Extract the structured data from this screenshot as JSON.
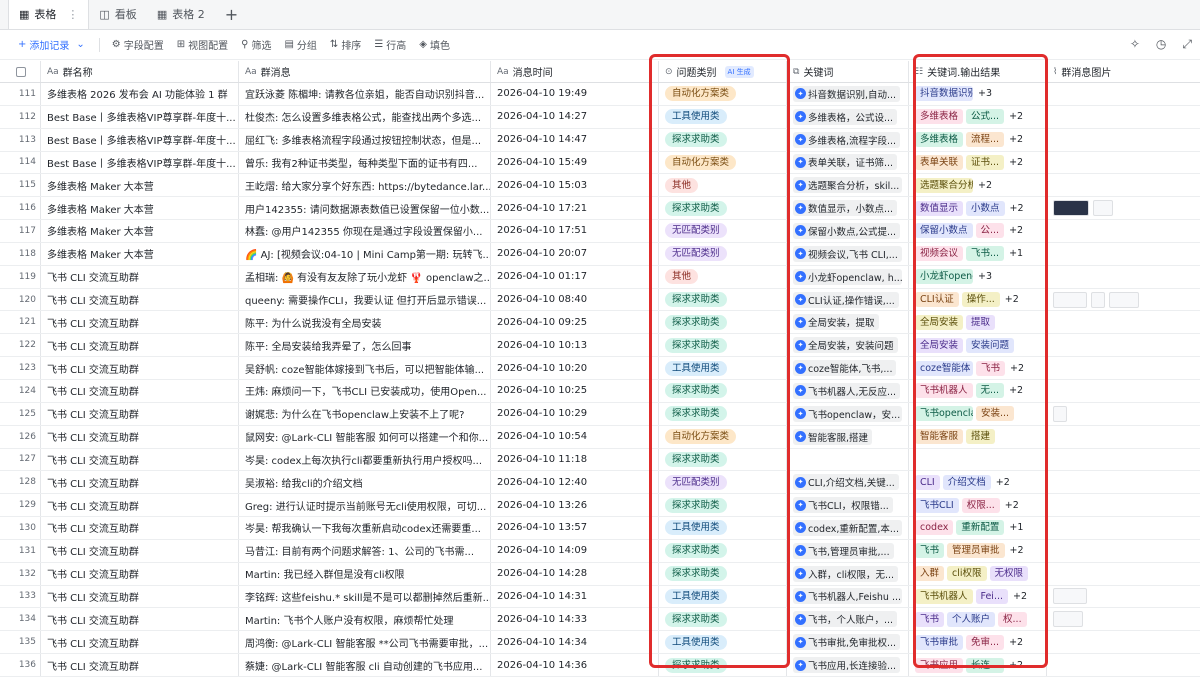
{
  "tabs": [
    {
      "label": "表格",
      "active": true,
      "icon": "table-icon"
    },
    {
      "label": "看板",
      "active": false,
      "icon": "kanban-icon"
    },
    {
      "label": "表格 2",
      "active": false,
      "icon": "table-icon"
    }
  ],
  "toolbar": {
    "add_record": "添加记录",
    "field_config": "字段配置",
    "view_config": "视图配置",
    "filter": "筛选",
    "group": "分组",
    "sort": "排序",
    "row_height": "行高",
    "fill": "填色"
  },
  "columns": {
    "group_name": "群名称",
    "group_message": "群消息",
    "message_time": "消息时间",
    "question_type": "问题类别",
    "ai_badge": "AI 生成",
    "keywords": "关键词",
    "keywords_output": "关键词.输出结果",
    "message_images": "群消息图片"
  },
  "rows": [
    {
      "no": "111",
      "group": "多维表格 2026 发布会 AI 功能体验 1 群",
      "msg": "宜跃泳菱 陈楣坤: 请教各位亲姐，能否自动识别抖音...",
      "time": "2026-04-10 19:49",
      "type": "自动化方案类",
      "tc": "o-auto",
      "kw": "抖音数据识别,自动...",
      "tags": [
        "抖音数据识别"
      ],
      "more": "+3",
      "imgs": []
    },
    {
      "no": "112",
      "group": "Best Base丨多维表格VIP尊享群-年度十...",
      "msg": "杜俊杰: 怎么设置多维表格公式，能查找出两个多选...",
      "time": "2026-04-10 14:27",
      "type": "工具使用类",
      "tc": "o-tool",
      "kw": "多维表格，公式设...",
      "tags": [
        "多维表格",
        "公式..."
      ],
      "more": "+2",
      "imgs": []
    },
    {
      "no": "113",
      "group": "Best Base丨多维表格VIP尊享群-年度十...",
      "msg": "屈红飞: 多维表格流程字段通过按钮控制状态，但是...",
      "time": "2026-04-10 14:47",
      "type": "探求求助类",
      "tc": "o-help",
      "kw": "多维表格,流程字段...",
      "tags": [
        "多维表格",
        "流程..."
      ],
      "more": "+2",
      "imgs": []
    },
    {
      "no": "114",
      "group": "Best Base丨多维表格VIP尊享群-年度十...",
      "msg": "曾乐: 我有2种证书类型，每种类型下面的证书有四...",
      "time": "2026-04-10 15:49",
      "type": "自动化方案类",
      "tc": "o-auto",
      "kw": "表单关联，证书筛...",
      "tags": [
        "表单关联",
        "证书..."
      ],
      "more": "+2",
      "imgs": []
    },
    {
      "no": "115",
      "group": "多维表格 Maker 大本营",
      "msg": "王屹熠: 给大家分享个好东西: https://bytedance.lar...",
      "time": "2026-04-10 15:03",
      "type": "其他",
      "tc": "o-other",
      "kw": "选题聚合分析，skil...",
      "tags": [
        "选题聚合分析"
      ],
      "more": "+2",
      "imgs": []
    },
    {
      "no": "116",
      "group": "多维表格 Maker 大本营",
      "msg": "用户142355: 请问数据源表数值已设置保留一位小数...",
      "time": "2026-04-10 17:21",
      "type": "探求求助类",
      "tc": "o-help",
      "kw": "数值显示，小数点...",
      "tags": [
        "数值显示",
        "小数点"
      ],
      "more": "+2",
      "imgs": [
        "dark",
        "w20"
      ]
    },
    {
      "no": "117",
      "group": "多维表格 Maker 大本营",
      "msg": "林蠢: @用户142355 你现在是通过字段设置保留小...",
      "time": "2026-04-10 17:51",
      "type": "无匹配类别",
      "tc": "o-none",
      "kw": "保留小数点,公式提...",
      "tags": [
        "保留小数点",
        "公..."
      ],
      "more": "+2",
      "imgs": []
    },
    {
      "no": "118",
      "group": "多维表格 Maker 大本营",
      "msg": "🌈 AJ: [视频会议:04-10 | Mini Camp第一期: 玩转飞...",
      "time": "2026-04-10 20:07",
      "type": "无匹配类别",
      "tc": "o-none",
      "kw": "视频会议,飞书 CLI,...",
      "tags": [
        "视频会议",
        "飞书..."
      ],
      "more": "+1",
      "imgs": []
    },
    {
      "no": "119",
      "group": "飞书 CLI 交流互助群",
      "msg": "孟相瑞: 🙆 有没有友友除了玩小龙虾 🦞 openclaw之...",
      "time": "2026-04-10 01:17",
      "type": "其他",
      "tc": "o-other",
      "kw": "小龙虾openclaw, h...",
      "tags": [
        "小龙虾openclaw"
      ],
      "more": "+3",
      "imgs": []
    },
    {
      "no": "120",
      "group": "飞书 CLI 交流互助群",
      "msg": "queeny: 需要操作CLI，我要认证 但打开后显示错误...",
      "time": "2026-04-10 08:40",
      "type": "探求求助类",
      "tc": "o-help",
      "kw": "CLI认证,操作错误,...",
      "tags": [
        "CLI认证",
        "操作..."
      ],
      "more": "+2",
      "imgs": [
        "w34",
        "w14",
        "w30"
      ]
    },
    {
      "no": "121",
      "group": "飞书 CLI 交流互助群",
      "msg": "陈平: 为什么说我没有全局安装",
      "time": "2026-04-10 09:25",
      "type": "探求求助类",
      "tc": "o-help",
      "kw": "全局安装，提取",
      "tags": [
        "全局安装",
        "提取"
      ],
      "more": "",
      "imgs": []
    },
    {
      "no": "122",
      "group": "飞书 CLI 交流互助群",
      "msg": "陈平: 全局安装给我弄晕了，怎么回事",
      "time": "2026-04-10 10:13",
      "type": "探求求助类",
      "tc": "o-help",
      "kw": "全局安装，安装问题",
      "tags": [
        "全局安装",
        "安装问题"
      ],
      "more": "",
      "imgs": []
    },
    {
      "no": "123",
      "group": "飞书 CLI 交流互助群",
      "msg": "吴舒帆: coze智能体嫁接到飞书后，可以把智能体输...",
      "time": "2026-04-10 10:20",
      "type": "工具使用类",
      "tc": "o-tool",
      "kw": "coze智能体,飞书,...",
      "tags": [
        "coze智能体",
        "飞书"
      ],
      "more": "+2",
      "imgs": []
    },
    {
      "no": "124",
      "group": "飞书 CLI 交流互助群",
      "msg": "王炜: 麻烦问一下，飞书CLI 已安装成功，使用Open...",
      "time": "2026-04-10 10:25",
      "type": "探求求助类",
      "tc": "o-help",
      "kw": "飞书机器人,无反应...",
      "tags": [
        "飞书机器人",
        "无..."
      ],
      "more": "+2",
      "imgs": []
    },
    {
      "no": "125",
      "group": "飞书 CLI 交流互助群",
      "msg": "谢娓悲: 为什么在飞书openclaw上安装不上了呢?",
      "time": "2026-04-10 10:29",
      "type": "探求求助类",
      "tc": "o-help",
      "kw": "飞书openclaw，安...",
      "tags": [
        "飞书openclaw",
        "安装..."
      ],
      "more": "",
      "imgs": [
        "w14"
      ]
    },
    {
      "no": "126",
      "group": "飞书 CLI 交流互助群",
      "msg": "鼠网安: @Lark-CLI 智能客服 如何可以搭建一个和你...",
      "time": "2026-04-10 10:54",
      "type": "自动化方案类",
      "tc": "o-auto",
      "kw": "智能客服,搭建",
      "tags": [
        "智能客服",
        "搭建"
      ],
      "more": "",
      "imgs": []
    },
    {
      "no": "127",
      "group": "飞书 CLI 交流互助群",
      "msg": "岑昊: codex上每次执行cli都要重新执行用户授权吗...",
      "time": "2026-04-10 11:18",
      "type": "探求求助类",
      "tc": "o-help",
      "kw": "",
      "tags": [],
      "more": "",
      "imgs": []
    },
    {
      "no": "128",
      "group": "飞书 CLI 交流互助群",
      "msg": "吴淑裕: 给我cli的介绍文档",
      "time": "2026-04-10 12:40",
      "type": "无匹配类别",
      "tc": "o-none",
      "kw": "CLI,介绍文档,关键...",
      "tags": [
        "CLI",
        "介绍文档"
      ],
      "more": "+2",
      "imgs": []
    },
    {
      "no": "129",
      "group": "飞书 CLI 交流互助群",
      "msg": "Greg: 进行认证时提示当前账号无cli使用权限，可切...",
      "time": "2026-04-10 13:26",
      "type": "探求求助类",
      "tc": "o-help",
      "kw": "飞书CLI，权限错...",
      "tags": [
        "飞书CLI",
        "权限..."
      ],
      "more": "+2",
      "imgs": []
    },
    {
      "no": "130",
      "group": "飞书 CLI 交流互助群",
      "msg": "岑昊: 帮我确认一下我每次重新启动codex还需要重...",
      "time": "2026-04-10 13:57",
      "type": "工具使用类",
      "tc": "o-tool",
      "kw": "codex,重新配置,本...",
      "tags": [
        "codex",
        "重新配置"
      ],
      "more": "+1",
      "imgs": []
    },
    {
      "no": "131",
      "group": "飞书 CLI 交流互助群",
      "msg": "马昔江: 目前有两个问题求解答: 1、公司的飞书需...",
      "time": "2026-04-10 14:09",
      "type": "探求求助类",
      "tc": "o-help",
      "kw": "飞书,管理员审批,...",
      "tags": [
        "飞书",
        "管理员审批"
      ],
      "more": "+2",
      "imgs": []
    },
    {
      "no": "132",
      "group": "飞书 CLI 交流互助群",
      "msg": "Martin: 我已经入群但是没有cli权限",
      "time": "2026-04-10 14:28",
      "type": "探求求助类",
      "tc": "o-help",
      "kw": "入群，cli权限，无...",
      "tags": [
        "入群",
        "cli权限",
        "无权限"
      ],
      "more": "",
      "imgs": []
    },
    {
      "no": "133",
      "group": "飞书 CLI 交流互助群",
      "msg": "李铭辉: 这些feishu.* skill是不是可以都删掉然后重新...",
      "time": "2026-04-10 14:31",
      "type": "工具使用类",
      "tc": "o-tool",
      "kw": "飞书机器人,Feishu ...",
      "tags": [
        "飞书机器人",
        "Fei..."
      ],
      "more": "+2",
      "imgs": [
        "w34"
      ]
    },
    {
      "no": "134",
      "group": "飞书 CLI 交流互助群",
      "msg": "Martin: 飞书个人账户没有权限，麻烦帮忙处理",
      "time": "2026-04-10 14:33",
      "type": "探求求助类",
      "tc": "o-help",
      "kw": "飞书，个人账户，...",
      "tags": [
        "飞书",
        "个人账户",
        "权..."
      ],
      "more": "",
      "imgs": [
        "w30"
      ]
    },
    {
      "no": "135",
      "group": "飞书 CLI 交流互助群",
      "msg": "周鸿衡: @Lark-CLI 智能客服 **公司飞书需要审批，...",
      "time": "2026-04-10 14:34",
      "type": "工具使用类",
      "tc": "o-tool",
      "kw": "飞书审批,免审批权...",
      "tags": [
        "飞书审批",
        "免审..."
      ],
      "more": "+2",
      "imgs": []
    },
    {
      "no": "136",
      "group": "飞书 CLI 交流互助群",
      "msg": "蔡婕: @Lark-CLI 智能客服 cli 自动创建的飞书应用...",
      "time": "2026-04-10 14:36",
      "type": "探求求助类",
      "tc": "o-help",
      "kw": "飞书应用,长连接验...",
      "tags": [
        "飞书应用",
        "长连..."
      ],
      "more": "+2",
      "imgs": []
    }
  ],
  "colors": {
    "highlight_border": "#e02c2c",
    "accent": "#3370ff"
  }
}
